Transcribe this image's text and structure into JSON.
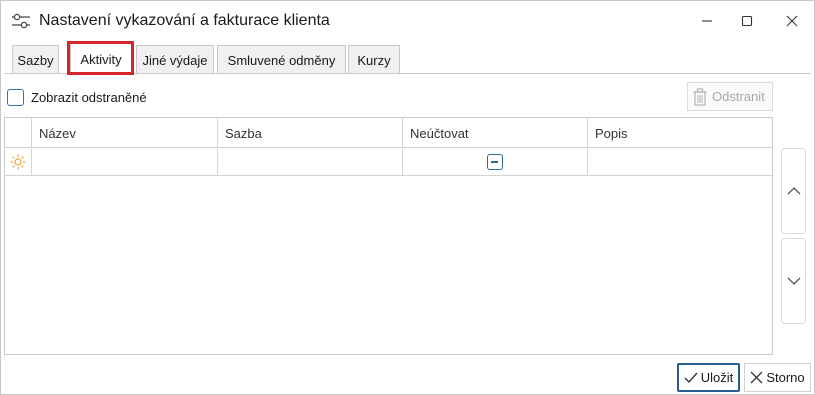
{
  "window": {
    "title": "Nastavení vykazování a fakturace klienta",
    "icon": "settings-sliders-icon"
  },
  "tabs": [
    {
      "label": "Sazby",
      "active": false
    },
    {
      "label": "Aktivity",
      "active": true
    },
    {
      "label": "Jiné výdaje",
      "active": false
    },
    {
      "label": "Smluvené odměny",
      "active": false
    },
    {
      "label": "Kurzy",
      "active": false
    }
  ],
  "toolbar": {
    "show_deleted_label": "Zobrazit odstraněné",
    "show_deleted_checked": false,
    "delete_label": "Odstranit",
    "delete_enabled": false
  },
  "grid": {
    "columns": [
      "Název",
      "Sazba",
      "Neúčtovat",
      "Popis"
    ],
    "new_row": {
      "nazev": "",
      "sazba": "",
      "neuctovat": "indeterminate",
      "popis": ""
    }
  },
  "footer": {
    "save_label": "Uložit",
    "cancel_label": "Storno"
  },
  "colors": {
    "highlight": "#d4252a",
    "accent": "#2a5d8f",
    "new_row_icon": "#f0a030"
  }
}
